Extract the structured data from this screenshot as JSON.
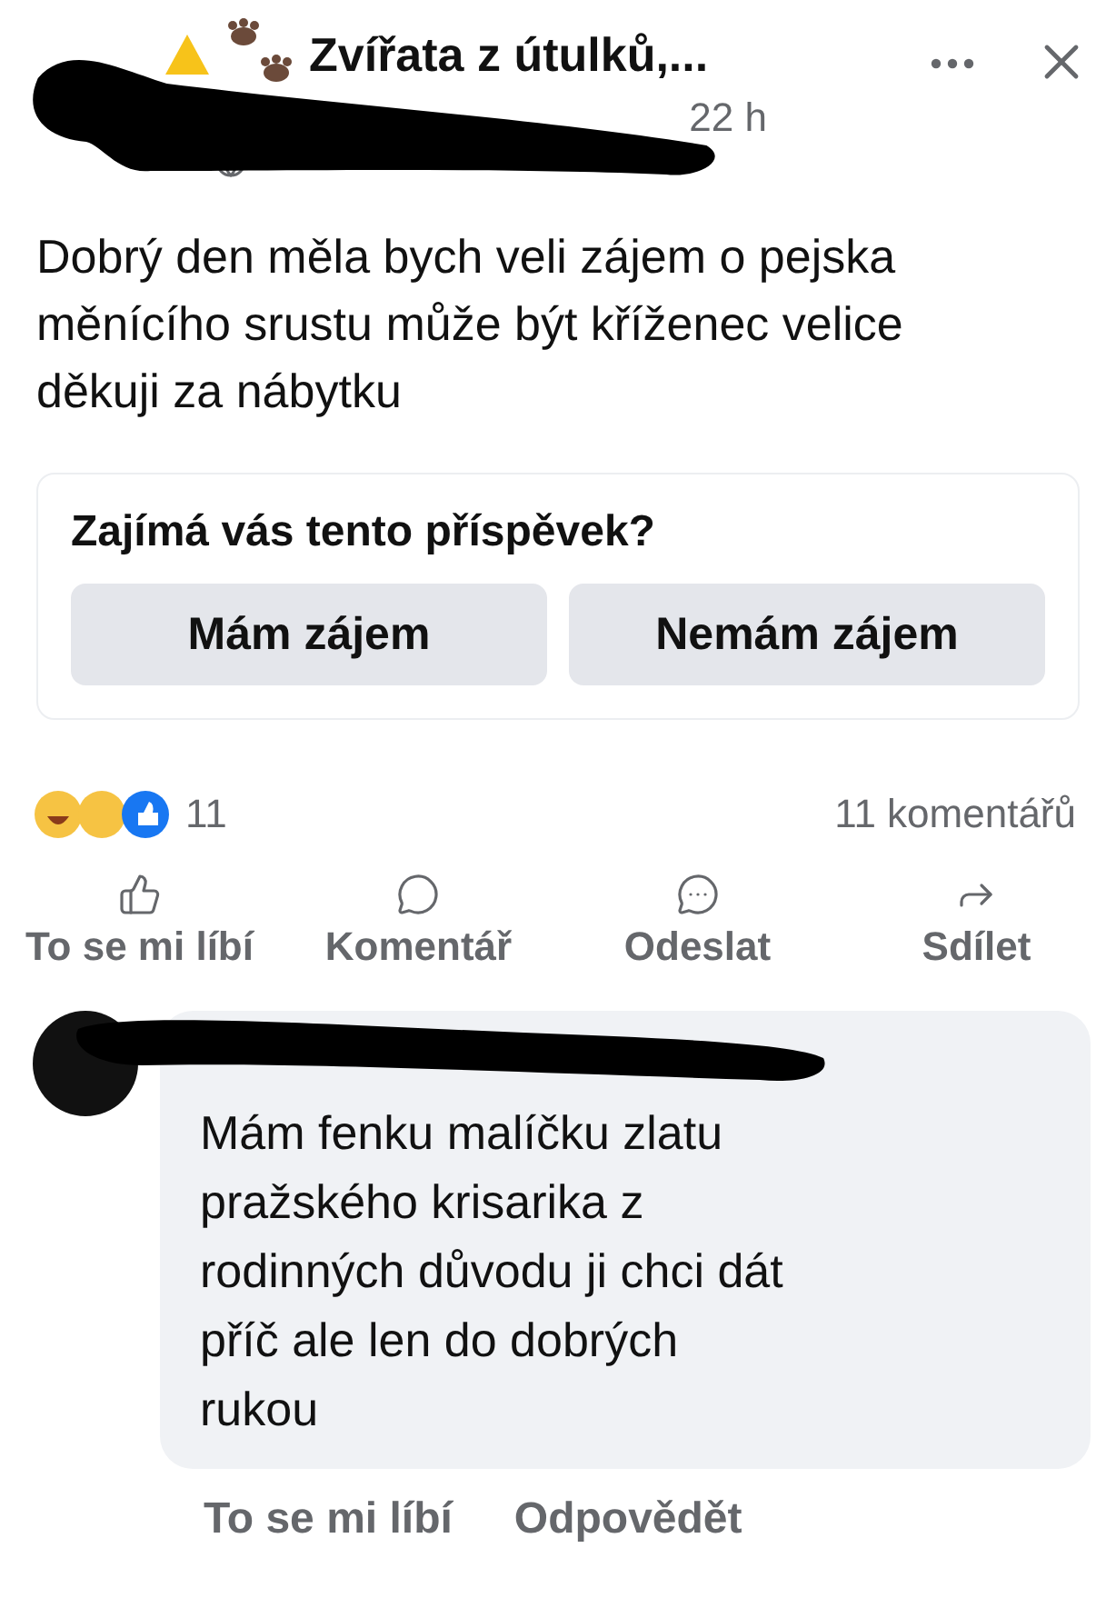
{
  "post": {
    "group": "Zvířata z útulků,...",
    "time": "22 h",
    "text": "Dobrý den měla bych veli zájem o pejska měnícího srustu může být kříženec velice děkuji za nábytku"
  },
  "interest": {
    "question": "Zajímá vás tento příspěvek?",
    "buttons": [
      "Mám zájem",
      "Nemám zájem"
    ]
  },
  "stats": {
    "reactions": "11",
    "comments": "11 komentářů"
  },
  "actions": [
    {
      "kind": "like",
      "label": "To se mi líbí"
    },
    {
      "kind": "comment",
      "label": "Komentář"
    },
    {
      "kind": "send",
      "label": "Odeslat"
    },
    {
      "kind": "share",
      "label": "Sdílet"
    }
  ],
  "comment": {
    "text": "Mám fenku malíčku zlatu pražského krisarika z rodinných důvodu ji chci dát příč ale len do dobrých rukou",
    "actions": [
      "To se mi líbí",
      "Odpovědět"
    ]
  }
}
